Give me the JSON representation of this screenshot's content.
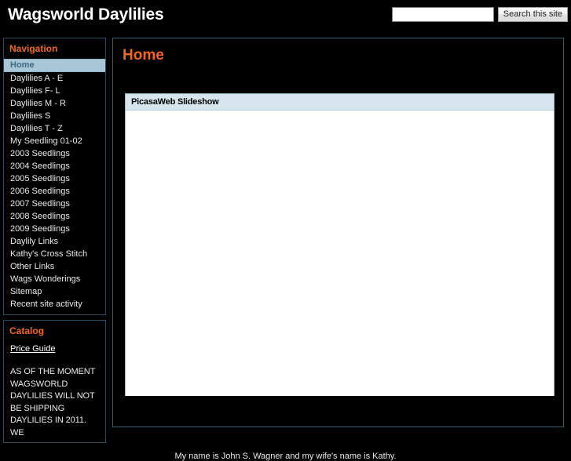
{
  "header": {
    "site_title": "Wagsworld Daylilies",
    "search": {
      "value": "",
      "placeholder": "",
      "button_label": "Search this site"
    }
  },
  "sidebar": {
    "navigation": {
      "title": "Navigation",
      "items": [
        {
          "label": "Home",
          "selected": true
        },
        {
          "label": "Daylilies A - E",
          "selected": false
        },
        {
          "label": "Daylilies F- L",
          "selected": false
        },
        {
          "label": "Daylilies M - R",
          "selected": false
        },
        {
          "label": "Daylilies S",
          "selected": false
        },
        {
          "label": "Daylilies T - Z",
          "selected": false
        },
        {
          "label": "My Seedling 01-02",
          "selected": false
        },
        {
          "label": "2003 Seedlings",
          "selected": false
        },
        {
          "label": "2004 Seedlings",
          "selected": false
        },
        {
          "label": "2005 Seedlings",
          "selected": false
        },
        {
          "label": "2006 Seedlings",
          "selected": false
        },
        {
          "label": "2007 Seedlings",
          "selected": false
        },
        {
          "label": "2008 Seedlings",
          "selected": false
        },
        {
          "label": "2009 Seedlings",
          "selected": false
        },
        {
          "label": "Daylily Links",
          "selected": false
        },
        {
          "label": "Kathy's Cross Stitch",
          "selected": false
        },
        {
          "label": "Other Links",
          "selected": false
        },
        {
          "label": "Wags Wonderings",
          "selected": false
        },
        {
          "label": "Sitemap",
          "selected": false
        },
        {
          "label": "Recent site activity",
          "selected": false
        }
      ]
    },
    "catalog": {
      "title": "Catalog",
      "price_guide_label": "Price Guide",
      "notice": "AS OF THE MOMENT WAGSWORLD DAYLILIES WILL NOT BE SHIPPING DAYLILIES IN 2011. WE"
    }
  },
  "main": {
    "heading": "Home",
    "slideshow": {
      "title": "PicasaWeb Slideshow"
    },
    "intro_text": "My name is John S. Wagner and my wife's name is Kathy."
  },
  "colors": {
    "page_background": "#000000",
    "accent_orange": "#f26522",
    "selected_nav_background": "#a8c6d6",
    "selected_nav_text": "#3d6b82",
    "panel_titlebar": "#d7e6ee",
    "box_border": "#2f4a5c"
  }
}
